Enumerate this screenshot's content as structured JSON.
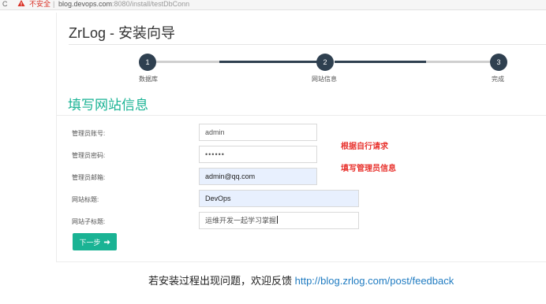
{
  "browser": {
    "reload_icon": "reload-icon",
    "warning_icon": "warning-triangle-icon",
    "insecure_label": "不安全",
    "url_host": "blog.devops.com",
    "url_rest": ":8080/install/testDbConn"
  },
  "header": {
    "title": "ZrLog - 安装向导"
  },
  "steps": [
    {
      "number": "1",
      "label": "数据库"
    },
    {
      "number": "2",
      "label": "网站信息"
    },
    {
      "number": "3",
      "label": "完成"
    }
  ],
  "section": {
    "title": "填写网站信息"
  },
  "form": {
    "fields": [
      {
        "label": "管理员账号:",
        "value": "admin"
      },
      {
        "label": "管理员密码:",
        "value": "••••••"
      },
      {
        "label": "管理员邮箱:",
        "value": "admin@qq.com"
      },
      {
        "label": "网站标题:",
        "value": "DevOps"
      },
      {
        "label": "网站子标题:",
        "value": "运维开发一起学习掌握"
      }
    ],
    "next_label": "下一步",
    "next_icon": "arrow-right-icon"
  },
  "annotations": {
    "line1": "根据自行请求",
    "line2": "填写管理员信息",
    "color": "#e8322d"
  },
  "footer": {
    "text": "若安装过程出现问题，欢迎反馈 ",
    "link": "http://blog.zrlog.com/post/feedback"
  },
  "colors": {
    "accent": "#1ab394",
    "step_dark": "#2f4050",
    "autofill": "#e8f0fe",
    "link": "#1f7bc1"
  }
}
